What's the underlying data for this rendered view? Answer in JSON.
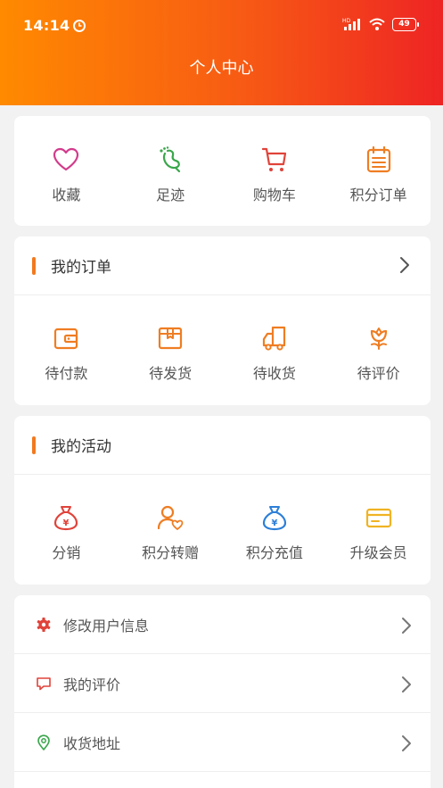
{
  "status_bar": {
    "time": "14:14",
    "network": "HD",
    "battery": "49"
  },
  "header": {
    "title": "个人中心"
  },
  "quick_links": [
    {
      "label": "收藏",
      "icon": "heart-icon",
      "color": "#d23c8c"
    },
    {
      "label": "足迹",
      "icon": "footprint-icon",
      "color": "#3aa64b"
    },
    {
      "label": "购物车",
      "icon": "cart-icon",
      "color": "#e0433a"
    },
    {
      "label": "积分订单",
      "icon": "calendar-list-icon",
      "color": "#ef7d22"
    }
  ],
  "orders": {
    "title": "我的订单",
    "items": [
      {
        "label": "待付款",
        "icon": "wallet-icon"
      },
      {
        "label": "待发货",
        "icon": "package-icon"
      },
      {
        "label": "待收货",
        "icon": "truck-icon"
      },
      {
        "label": "待评价",
        "icon": "flower-icon"
      }
    ]
  },
  "activities": {
    "title": "我的活动",
    "items": [
      {
        "label": "分销",
        "icon": "money-bag-icon",
        "color": "#e0433a"
      },
      {
        "label": "积分转赠",
        "icon": "user-heart-icon",
        "color": "#ef7d22"
      },
      {
        "label": "积分充值",
        "icon": "money-bag-blue-icon",
        "color": "#2c7fd8"
      },
      {
        "label": "升级会员",
        "icon": "card-icon",
        "color": "#f0b323"
      }
    ]
  },
  "menu": [
    {
      "label": "修改用户信息",
      "icon": "gear-icon",
      "color": "#e0433a"
    },
    {
      "label": "我的评价",
      "icon": "comment-icon",
      "color": "#e0433a"
    },
    {
      "label": "收货地址",
      "icon": "location-icon",
      "color": "#3aa64b"
    }
  ],
  "colors": {
    "accent": "#f17a1f",
    "header_start": "#ff8a00",
    "header_end": "#ee2424"
  }
}
